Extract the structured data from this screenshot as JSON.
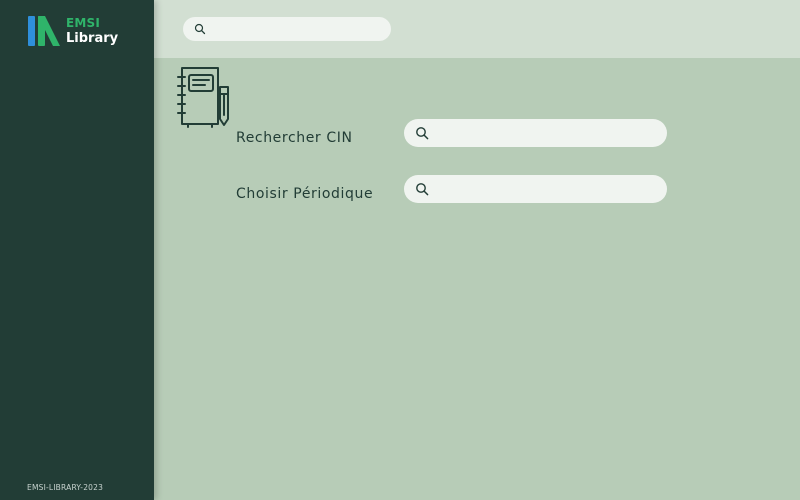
{
  "brand": {
    "line1": "EMSI",
    "line2": "Library",
    "footer": "EMSI-LIBRARY-2023"
  },
  "topbar": {
    "search_value": "",
    "search_icon": "search-icon"
  },
  "form": {
    "page_icon": "notebook-pen-icon",
    "cin_label": "Rechercher CIN",
    "cin_value": "",
    "periodique_label": "Choisir Périodique",
    "periodique_value": ""
  },
  "colors": {
    "sidebar": "#223d36",
    "topbar": "#d2dfd2",
    "content": "#b7ccb7",
    "input": "#f0f4f0",
    "logo_blue": "#2f8fdb",
    "logo_green": "#2fb46a"
  }
}
